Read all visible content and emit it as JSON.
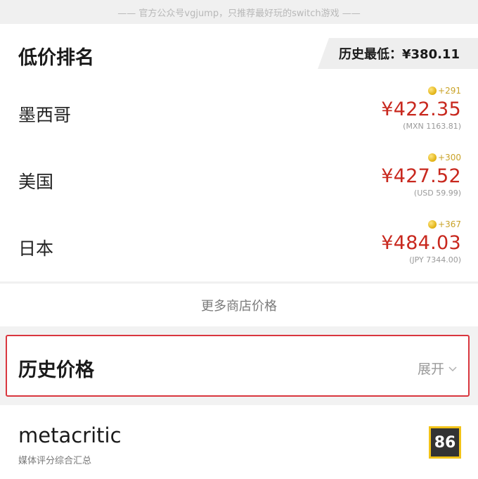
{
  "banner": {
    "text": "—— 官方公众号vgjump，只推荐最好玩的switch游戏 ——"
  },
  "low_price_section": {
    "title": "低价排名",
    "lowest_label": "历史最低：¥380.11",
    "regions": [
      {
        "name": "墨西哥",
        "points": "+291",
        "price": "¥422.35",
        "original": "(MXN 1163.81)"
      },
      {
        "name": "美国",
        "points": "+300",
        "price": "¥427.52",
        "original": "(USD 59.99)"
      },
      {
        "name": "日本",
        "points": "+367",
        "price": "¥484.03",
        "original": "(JPY 7344.00)"
      }
    ],
    "more_label": "更多商店价格"
  },
  "history_section": {
    "title": "历史价格",
    "expand_label": "展开"
  },
  "metacritic": {
    "title": "metacritic",
    "subtitle": "媒体评分综合汇总",
    "score": "86"
  },
  "colors": {
    "price_red": "#c8281e",
    "highlight_border": "#d9363e",
    "score_border": "#f2c318",
    "coin_gold": "#c9a227"
  },
  "icons": {
    "points": "coin-icon",
    "expand": "chevron-down-icon"
  }
}
